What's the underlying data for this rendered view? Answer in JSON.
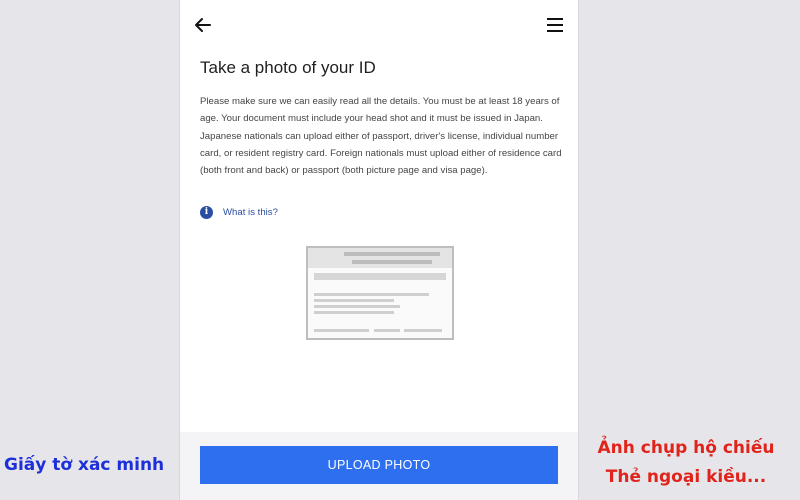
{
  "screen": {
    "title": "Take a photo of your ID",
    "description": "Please make sure we can easily read all the details. You must be at least 18 years of age. Your document must include your head shot and it must be issued in Japan. Japanese nationals can upload either of passport, driver's license, individual number card, or resident registry card. Foreign nationals must upload either of residence card (both front and back) or passport (both picture page and visa page).",
    "help_link": "What is this?",
    "upload_button": "UPLOAD PHOTO"
  },
  "icons": {
    "back": "back-arrow-icon",
    "menu": "hamburger-menu-icon",
    "info": "info-icon",
    "info_glyph": "i"
  },
  "illustration": {
    "name": "id-card-illustration"
  },
  "captions": {
    "left": "Giấy tờ xác minh",
    "right_line1": "Ảnh chụp hộ chiếu",
    "right_line2": "Thẻ ngoại kiều..."
  },
  "colors": {
    "primary_button": "#2e6ff0",
    "link": "#2b4ea3",
    "caption_left": "#1c2fd9",
    "caption_right": "#e0231b"
  }
}
